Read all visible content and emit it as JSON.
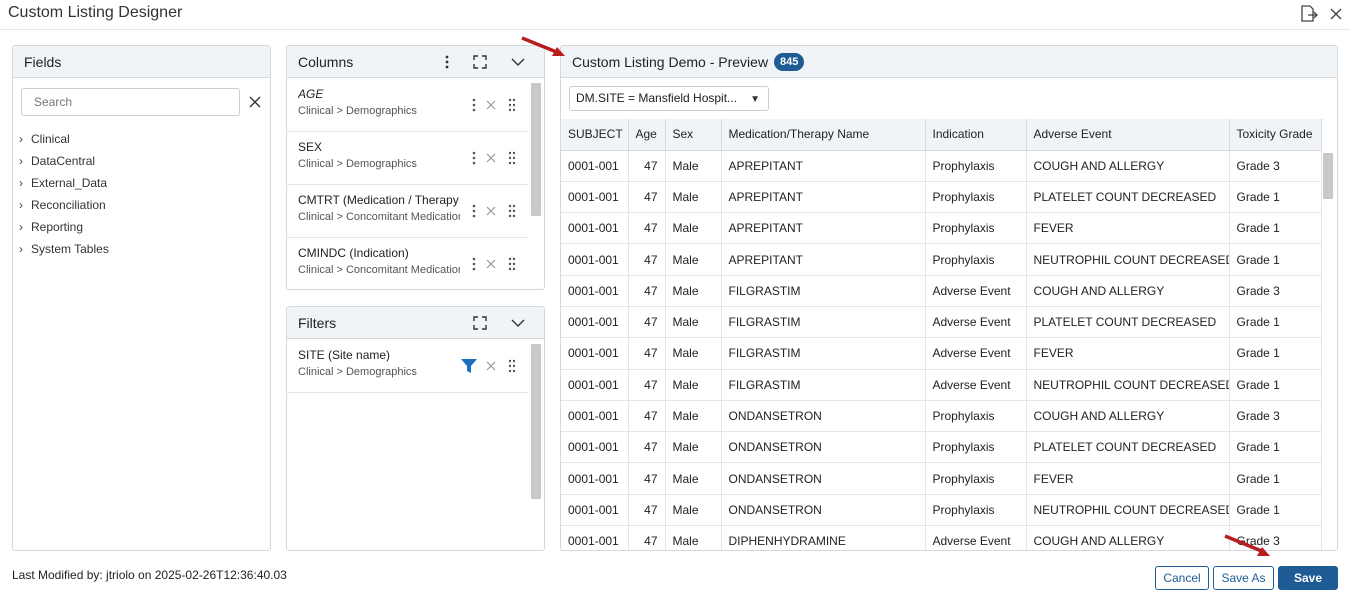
{
  "window": {
    "title": "Custom Listing Designer"
  },
  "fields": {
    "title": "Fields",
    "search_placeholder": "Search",
    "tree": [
      "Clinical",
      "DataCentral",
      "External_Data",
      "Reconciliation",
      "Reporting",
      "System Tables"
    ]
  },
  "columns": {
    "title": "Columns",
    "items": [
      {
        "name": "AGE",
        "path": "Clinical > Demographics"
      },
      {
        "name": "SEX",
        "path": "Clinical > Demographics"
      },
      {
        "name": "CMTRT (Medication / Therapy Name)",
        "path": "Clinical > Concomitant Medications"
      },
      {
        "name": "CMINDC (Indication)",
        "path": "Clinical > Concomitant Medications"
      }
    ]
  },
  "filters": {
    "title": "Filters",
    "items": [
      {
        "name": "SITE (Site name)",
        "path": "Clinical > Demographics"
      }
    ]
  },
  "preview": {
    "title": "Custom Listing Demo - Preview",
    "count": "845",
    "filter_value": "DM.SITE = Mansfield Hospit...",
    "headers": [
      "SUBJECT",
      "Age",
      "Sex",
      "Medication/Therapy Name",
      "Indication",
      "Adverse Event",
      "Toxicity Grade"
    ],
    "rows": [
      [
        "0001-001",
        "47",
        "Male",
        "APREPITANT",
        "Prophylaxis",
        "COUGH AND ALLERGY",
        "Grade 3"
      ],
      [
        "0001-001",
        "47",
        "Male",
        "APREPITANT",
        "Prophylaxis",
        "PLATELET COUNT DECREASED",
        "Grade 1"
      ],
      [
        "0001-001",
        "47",
        "Male",
        "APREPITANT",
        "Prophylaxis",
        "FEVER",
        "Grade 1"
      ],
      [
        "0001-001",
        "47",
        "Male",
        "APREPITANT",
        "Prophylaxis",
        "NEUTROPHIL COUNT DECREASED",
        "Grade 1"
      ],
      [
        "0001-001",
        "47",
        "Male",
        "FILGRASTIM",
        "Adverse Event",
        "COUGH AND ALLERGY",
        "Grade 3"
      ],
      [
        "0001-001",
        "47",
        "Male",
        "FILGRASTIM",
        "Adverse Event",
        "PLATELET COUNT DECREASED",
        "Grade 1"
      ],
      [
        "0001-001",
        "47",
        "Male",
        "FILGRASTIM",
        "Adverse Event",
        "FEVER",
        "Grade 1"
      ],
      [
        "0001-001",
        "47",
        "Male",
        "FILGRASTIM",
        "Adverse Event",
        "NEUTROPHIL COUNT DECREASED",
        "Grade 1"
      ],
      [
        "0001-001",
        "47",
        "Male",
        "ONDANSETRON",
        "Prophylaxis",
        "COUGH AND ALLERGY",
        "Grade 3"
      ],
      [
        "0001-001",
        "47",
        "Male",
        "ONDANSETRON",
        "Prophylaxis",
        "PLATELET COUNT DECREASED",
        "Grade 1"
      ],
      [
        "0001-001",
        "47",
        "Male",
        "ONDANSETRON",
        "Prophylaxis",
        "FEVER",
        "Grade 1"
      ],
      [
        "0001-001",
        "47",
        "Male",
        "ONDANSETRON",
        "Prophylaxis",
        "NEUTROPHIL COUNT DECREASED",
        "Grade 1"
      ],
      [
        "0001-001",
        "47",
        "Male",
        "DIPHENHYDRAMINE",
        "Adverse Event",
        "COUGH AND ALLERGY",
        "Grade 3"
      ]
    ]
  },
  "footer": {
    "last_modified": "Last Modified by: jtriolo on 2025-02-26T12:36:40.03",
    "cancel_label": "Cancel",
    "save_as_label": "Save As",
    "save_label": "Save"
  },
  "colors": {
    "accent": "#1f5c95",
    "annotation_arrow": "#b81d1d",
    "filter_icon": "#1f6fbf"
  }
}
